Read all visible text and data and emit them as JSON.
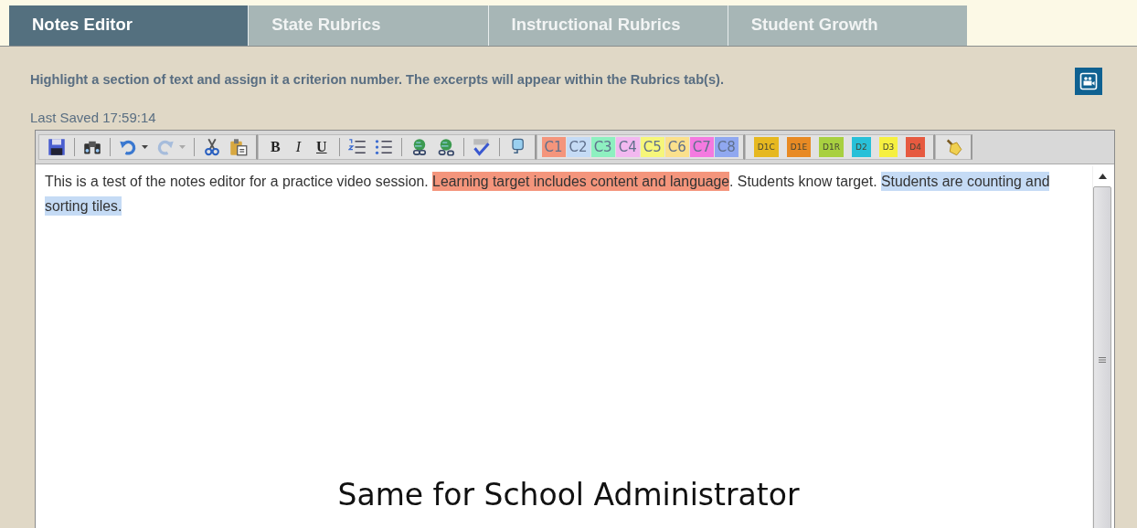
{
  "tabs": [
    {
      "label": "Notes Editor",
      "selected": true
    },
    {
      "label": "State Rubrics",
      "selected": false
    },
    {
      "label": "Instructional Rubrics",
      "selected": false
    },
    {
      "label": "Student Growth",
      "selected": false
    }
  ],
  "instructions": "Highlight a section of text and assign it a criterion number. The excerpts will appear within the Rubrics tab(s).",
  "last_saved": "Last Saved 17:59:14",
  "toolbar": {
    "groups": [
      {
        "items": [
          {
            "kind": "save"
          },
          {
            "kind": "find"
          },
          {
            "kind": "undo",
            "disabled": false
          },
          {
            "kind": "redo",
            "disabled": true
          },
          {
            "kind": "cut"
          },
          {
            "kind": "paste"
          }
        ]
      },
      {
        "items": [
          {
            "kind": "bold",
            "label": "B"
          },
          {
            "kind": "italic",
            "label": "I"
          },
          {
            "kind": "underline",
            "label": "U"
          },
          {
            "kind": "ordered-list"
          },
          {
            "kind": "bullet-list"
          },
          {
            "kind": "link"
          },
          {
            "kind": "unlink"
          },
          {
            "kind": "spellcheck"
          },
          {
            "kind": "template"
          }
        ]
      },
      {
        "items": [
          {
            "kind": "criterion",
            "label": "C1",
            "color": "#f4957c"
          },
          {
            "kind": "criterion",
            "label": "C2",
            "color": "#c5dbf5"
          },
          {
            "kind": "criterion",
            "label": "C3",
            "color": "#8ef0c0"
          },
          {
            "kind": "criterion",
            "label": "C4",
            "color": "#f2b8f0"
          },
          {
            "kind": "criterion",
            "label": "C5",
            "color": "#f6f67a"
          },
          {
            "kind": "criterion",
            "label": "C6",
            "color": "#fbe08c"
          },
          {
            "kind": "criterion",
            "label": "C7",
            "color": "#f47ae0"
          },
          {
            "kind": "criterion",
            "label": "C8",
            "color": "#90a8f0"
          }
        ]
      },
      {
        "items": [
          {
            "kind": "domain",
            "label": "D1C",
            "color": "#e6b820"
          },
          {
            "kind": "domain",
            "label": "D1E",
            "color": "#e88a24"
          },
          {
            "kind": "domain",
            "label": "D1R",
            "color": "#a8d040"
          },
          {
            "kind": "domain",
            "label": "D2",
            "color": "#28c0d8"
          },
          {
            "kind": "domain",
            "label": "D3",
            "color": "#f6f040"
          },
          {
            "kind": "domain",
            "label": "D4",
            "color": "#e65a40"
          }
        ]
      },
      {
        "items": [
          {
            "kind": "clear"
          }
        ]
      }
    ]
  },
  "editor": {
    "segments": [
      {
        "text": "This is a test of the notes editor for a practice video session.  "
      },
      {
        "text": "Learning target includes content and language",
        "color": "#f4957c"
      },
      {
        "text": ".  Students know target.  "
      },
      {
        "text": "Students are counting and sorting tiles.",
        "color": "#c5dbf5"
      }
    ]
  },
  "caption": "Same for School Administrator"
}
